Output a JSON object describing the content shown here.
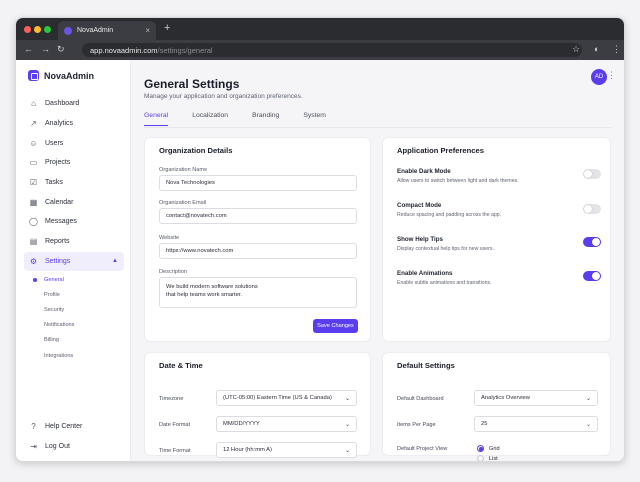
{
  "browser": {
    "tab_title": "NovaAdmin",
    "url_host": "app.novaadmin.com",
    "url_path": "/settings/general"
  },
  "sidebar": {
    "brand": "NovaAdmin",
    "items": [
      {
        "label": "Dashboard",
        "icon": "home-icon"
      },
      {
        "label": "Analytics",
        "icon": "chart-icon"
      },
      {
        "label": "Users",
        "icon": "users-icon"
      },
      {
        "label": "Projects",
        "icon": "folder-icon"
      },
      {
        "label": "Tasks",
        "icon": "checkbox-icon"
      },
      {
        "label": "Calendar",
        "icon": "calendar-icon"
      },
      {
        "label": "Messages",
        "icon": "message-icon"
      },
      {
        "label": "Reports",
        "icon": "file-icon"
      },
      {
        "label": "Settings",
        "icon": "gear-icon"
      }
    ],
    "sub_items": [
      "General",
      "Profile",
      "Security",
      "Notifications",
      "Billing",
      "Integrations"
    ],
    "bottom": [
      {
        "label": "Help Center",
        "icon": "help-icon"
      },
      {
        "label": "Log Out",
        "icon": "logout-icon"
      }
    ]
  },
  "header": {
    "title": "General Settings",
    "subtitle": "Manage your application and organization preferences.",
    "avatar": "AD"
  },
  "tabs": [
    "General",
    "Localization",
    "Branding",
    "System"
  ],
  "org": {
    "title": "Organization Details",
    "name_label": "Organization Name",
    "name_value": "Nova Technologies",
    "email_label": "Organization Email",
    "email_value": "contact@novatech.com",
    "website_label": "Website",
    "website_value": "https://www.novatech.com",
    "desc_label": "Description",
    "desc_line1": "We build modern software solutions",
    "desc_line2": "that help teams work smarter.",
    "save": "Save Changes"
  },
  "prefs": {
    "title": "Application Preferences",
    "items": [
      {
        "title": "Enable Dark Mode",
        "desc": "Allow users to switch between light and dark themes.",
        "on": false
      },
      {
        "title": "Compact Mode",
        "desc": "Reduce spacing and padding across the app.",
        "on": false
      },
      {
        "title": "Show Help Tips",
        "desc": "Display contextual help tips for new users.",
        "on": true
      },
      {
        "title": "Enable Animations",
        "desc": "Enable subtle animations and transitions.",
        "on": true
      }
    ]
  },
  "datetime": {
    "title": "Date & Time",
    "timezone_label": "Timezone",
    "timezone_value": "(UTC-05:00) Eastern Time (US & Canada)",
    "date_label": "Date Format",
    "date_value": "MM/DD/YYYY",
    "time_label": "Time Format",
    "time_value": "12 Hour (hh:mm A)"
  },
  "defaults": {
    "title": "Default Settings",
    "dashboard_label": "Default Dashboard",
    "dashboard_value": "Analytics Overview",
    "items_label": "Items Per Page",
    "items_value": "25",
    "view_label": "Default Project View",
    "view_options": [
      "Grid",
      "List"
    ],
    "view_selected": "Grid"
  },
  "colors": {
    "accent": "#5b3df0",
    "toggle_off": "#e4e4e8"
  }
}
